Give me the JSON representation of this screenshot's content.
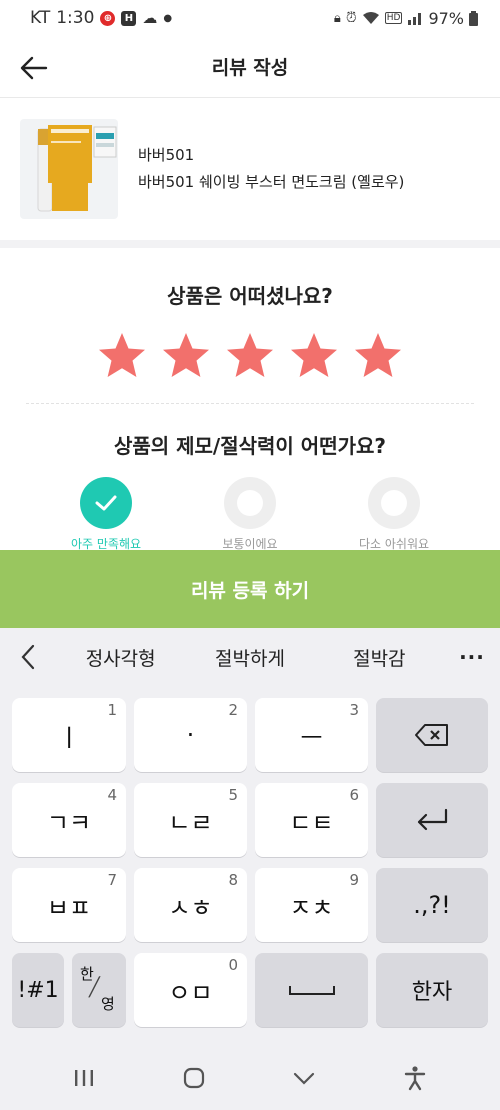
{
  "status_bar": {
    "carrier": "KT",
    "time": "1:30",
    "battery": "97%",
    "hd_badge": "HD",
    "notif_h": "H"
  },
  "header": {
    "title": "리뷰 작성"
  },
  "product": {
    "brand": "바버501",
    "name": "바버501 쉐이빙 부스터 면도크림 (옐로우)"
  },
  "rating": {
    "question": "상품은 어떠셨나요?",
    "stars": 5,
    "max_stars": 5,
    "star_color": "#f2706c"
  },
  "shave": {
    "question": "상품의 제모/절삭력이 어떤가요?",
    "options": [
      {
        "label": "아주 만족해요",
        "selected": true
      },
      {
        "label": "보통이에요",
        "selected": false
      },
      {
        "label": "다소 아쉬워요",
        "selected": false
      }
    ],
    "accent": "#1fc9b2"
  },
  "submit": {
    "label": "리뷰 등록 하기",
    "color": "#99c65f"
  },
  "keyboard": {
    "suggestions": [
      "정사각형",
      "절박하게",
      "절박감"
    ],
    "more": "···",
    "keys": {
      "r1c1": "ㅣ",
      "r1c1n": "1",
      "r1c2": "·",
      "r1c2n": "2",
      "r1c3": "ㅡ",
      "r1c3n": "3",
      "r2c1": "ㄱㅋ",
      "r2c1n": "4",
      "r2c2": "ㄴㄹ",
      "r2c2n": "5",
      "r2c3": "ㄷㅌ",
      "r2c3n": "6",
      "r3c1": "ㅂㅍ",
      "r3c1n": "7",
      "r3c2": "ㅅㅎ",
      "r3c2n": "8",
      "r3c3": "ㅈㅊ",
      "r3c3n": "9",
      "r3c4": ".,?!",
      "r4c1": "!#1",
      "r4c2a": "한",
      "r4c2b": "영",
      "r4c3": "ㅇㅁ",
      "r4c3n": "0",
      "r4c5": "한자"
    }
  }
}
